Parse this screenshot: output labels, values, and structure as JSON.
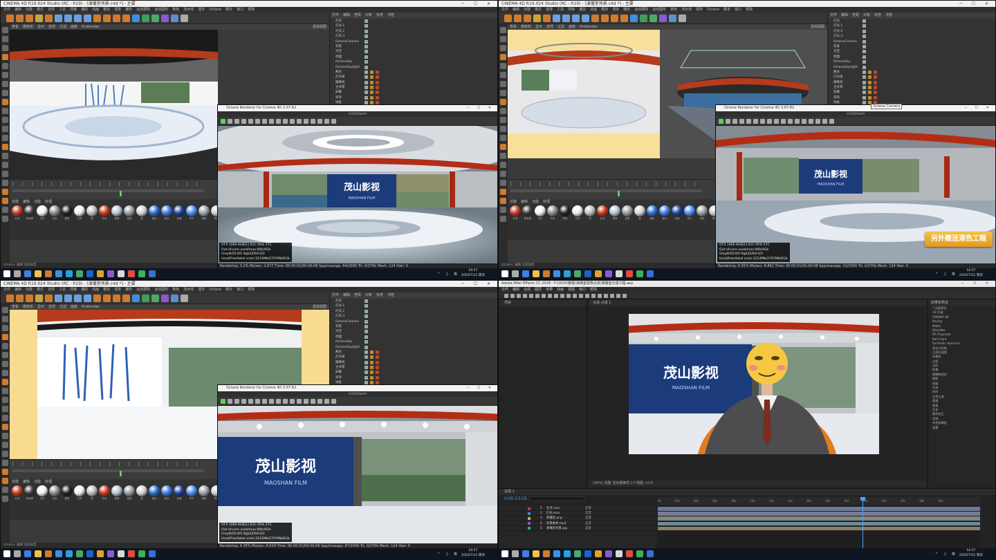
{
  "c4d": {
    "window_title": "CINEMA 4D R19.024 Studio (RC - R19) - [演播室场景.c4d *] - 主要",
    "menus": [
      "文件",
      "编辑",
      "创建",
      "模式",
      "选择",
      "工具",
      "网格",
      "捕捉",
      "动画",
      "模拟",
      "渲染",
      "雕刻",
      "运动跟踪",
      "运动图形",
      "角色",
      "流水线",
      "插件",
      "Octane",
      "脚本",
      "窗口",
      "帮助"
    ],
    "viewport_menus": [
      "查看",
      "摄像机",
      "显示",
      "选项",
      "过滤",
      "面板",
      "ProRender"
    ],
    "viewport_label": "透视视图",
    "object_header": [
      "文件",
      "编辑",
      "查看",
      "对象",
      "标签",
      "书签"
    ],
    "objects": [
      "灯光",
      "灯光.1",
      "灯光.2",
      "灯光.3",
      "OctaneCamera",
      "背景",
      "天空",
      "地面",
      "OctaneSky",
      "OctaneDaylight",
      "舞台",
      "灯光组",
      "摄像机",
      "主背景",
      "屏幕",
      "装饰",
      "地板"
    ],
    "material_header": [
      "创建",
      "编辑",
      "功能",
      "纹理"
    ],
    "material_labels": [
      "红漆",
      "黑金属",
      "白色",
      "灰色",
      "黑色",
      "白漆",
      "铬",
      "红色",
      "玻璃",
      "金属",
      "银",
      "蓝色",
      "蓝光",
      "深蓝",
      "发光",
      "地面",
      "地砖"
    ],
    "status_text": "Octane: 编辑 渲染进度",
    "timeline_frames": [
      "0",
      "10",
      "20",
      "30",
      "40",
      "50",
      "60",
      "70",
      "80",
      "90"
    ],
    "frame_display": "0 F"
  },
  "octane": {
    "window_title": "Octane Renderer for Cinema 4D 3.07-R2",
    "subtitle": "<Untitled>",
    "gpu_line": "GTX 1060 6GB[1] 61C         95%     57C",
    "memory_line": "Out-of-core used/max:0Kb/4Gb",
    "grey_line": "Grey8/16:0/0       Rgb32/64:0/2",
    "texture_line": "Used/free/total vram:3214Mb/2797Mb/6Gb",
    "q1_status": "Rendering: 3.2%   Ms/sec: 1.677   Time: 00:00:01/00:00:06   Spp/maxspp: 64/2000   Tri: 0/370k   Mesh: 124   Hair: 0",
    "q2_status": "Rendering: 0.55%   Ms/sec: 8.861   Time: 00:00:01/00:00:08   Spp/maxspp: 11/2000   Tri: 0/370k   Mesh: 124   Hair: 0",
    "q3_status": "Rendering: 4.35%   Ms/sec: 8.624   Time: 00:00:01/00:00:06   Spp/maxspp: 87/2000   Tri: 0/370k   Mesh: 124   Hair: 0"
  },
  "tooltip": "Octane Camera",
  "ribbon": "另外赠送滚色工程",
  "logo": {
    "cn": "茂山影视",
    "en": "MAOSHAN FILM"
  },
  "taskbar": {
    "time": "16:57",
    "date": "2020/7/12 周日",
    "tray": "^ ♫ 英"
  },
  "ae": {
    "window_title": "Adobe After Effects CC 2018 - F:\\2020\\教程\\演播室抠像合成\\演播室合成工程.aep",
    "menus": [
      "文件",
      "编辑",
      "合成",
      "图层",
      "效果",
      "动画",
      "视图",
      "窗口",
      "帮助"
    ],
    "project_tab": "项目",
    "comp_tab": "合成 合成 1",
    "comp_footer": "(50%)   完整   活动摄像机   1个视图   +0.0",
    "effects_header": "效果和预设",
    "effects": [
      "* 动画预设",
      "3D 声道",
      "CINEMA 4D",
      "Keying",
      "Matte",
      "Obsolete",
      "RG Trapcode",
      "Red Giant",
      "Synthetic Aperture",
      "表达式控制",
      "沉浸式视频",
      "风格化",
      "过渡",
      "过时",
      "抠像",
      "模糊和锐化",
      "模拟",
      "扭曲",
      "生成",
      "时间",
      "实用工具",
      "通道",
      "透视",
      "文本",
      "颜色校正",
      "音频",
      "杂色和颗粒",
      "遮罩"
    ],
    "timeline_tab": "合成 1",
    "timecode": "0:00:13:15",
    "layers": [
      {
        "num": "1",
        "name": "主持.mov",
        "mode": "正常"
      },
      {
        "num": "2",
        "name": "灯光.mov",
        "mode": "正常"
      },
      {
        "num": "3",
        "name": "演播室.png",
        "mode": "正常"
      },
      {
        "num": "4",
        "name": "背景素材.mp4",
        "mode": "正常"
      },
      {
        "num": "5",
        "name": "演播室背景.jpg",
        "mode": "正常"
      }
    ],
    "ruler_labels": [
      "0s",
      "02s",
      "04s",
      "06s",
      "08s",
      "10s",
      "12s",
      "14s",
      "16s",
      "18s",
      "20s",
      "22s",
      "24s",
      "26s",
      "28s",
      "30s"
    ],
    "playhead_position": 0.635
  },
  "colors": {
    "c4d_orange": "#d07a2e",
    "octane_green": "#5fd05f",
    "ae_blue": "#4aa3ff",
    "ribbon": "#f2b43a"
  }
}
